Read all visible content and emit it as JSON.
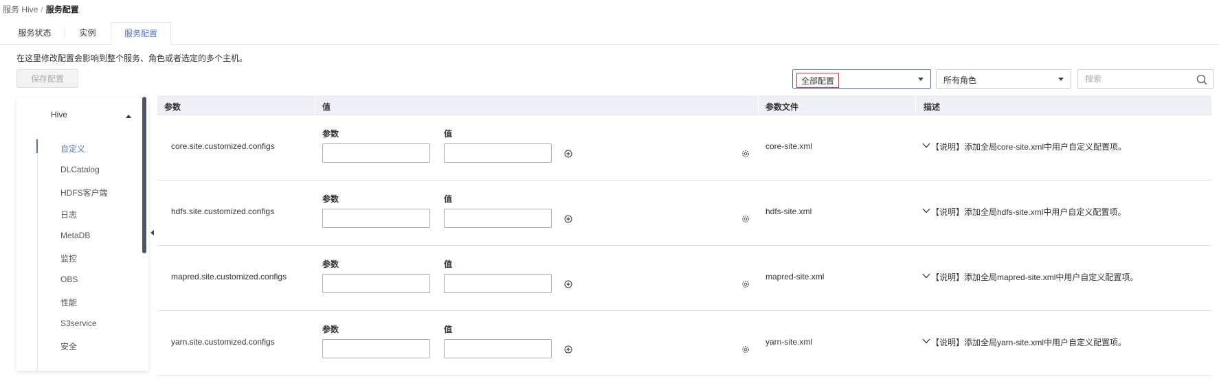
{
  "breadcrumb": {
    "root": "服务 Hive",
    "separator": "/",
    "current": "服务配置"
  },
  "tabs": [
    {
      "label": "服务状态"
    },
    {
      "label": "实例"
    },
    {
      "label": "服务配置",
      "active": true
    }
  ],
  "hint": "在这里修改配置会影响到整个服务、角色或者选定的多个主机。",
  "toolbar": {
    "save_label": "保存配置",
    "config_scope": "全部配置",
    "role_filter": "所有角色",
    "search_placeholder": "搜索"
  },
  "sidebar": {
    "group": "Hive",
    "items": [
      {
        "label": "自定义",
        "active": true
      },
      {
        "label": "DLCatalog"
      },
      {
        "label": "HDFS客户端"
      },
      {
        "label": "日志"
      },
      {
        "label": "MetaDB"
      },
      {
        "label": "监控"
      },
      {
        "label": "OBS"
      },
      {
        "label": "性能"
      },
      {
        "label": "S3service"
      },
      {
        "label": "安全"
      }
    ]
  },
  "table": {
    "headers": {
      "param": "参数",
      "value": "值",
      "file": "参数文件",
      "desc": "描述"
    },
    "sub_labels": {
      "param": "参数",
      "value": "值"
    },
    "rows": [
      {
        "name": "core.site.customized.configs",
        "file": "core-site.xml",
        "desc": "【说明】添加全局core-site.xml中用户自定义配置项。"
      },
      {
        "name": "hdfs.site.customized.configs",
        "file": "hdfs-site.xml",
        "desc": "【说明】添加全局hdfs-site.xml中用户自定义配置项。"
      },
      {
        "name": "mapred.site.customized.configs",
        "file": "mapred-site.xml",
        "desc": "【说明】添加全局mapred-site.xml中用户自定义配置项。"
      },
      {
        "name": "yarn.site.customized.configs",
        "file": "yarn-site.xml",
        "desc": "【说明】添加全局yarn-site.xml中用户自定义配置项。"
      }
    ]
  },
  "colors": {
    "accent": "#526ecc",
    "highlight_border": "#e4393c",
    "header_bg": "#eef0f5"
  }
}
